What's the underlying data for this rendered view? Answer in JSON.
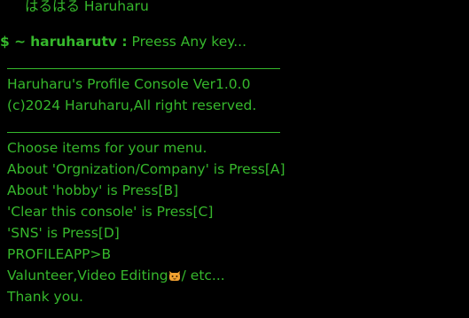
{
  "header": {
    "title": "はるはる Haruharu"
  },
  "prompt": {
    "symbol": "$ ~",
    "user": "haruharutv :",
    "message": "Preess Any key..."
  },
  "console": {
    "banner_line1": "Haruharu's Profile Console Ver1.0.0",
    "banner_line2": "(c)2024 Haruharu,All right reserved."
  },
  "menu": {
    "intro": "Choose items for your menu.",
    "items": [
      "About 'Orgnization/Company' is Press[A]",
      "About 'hobby' is Press[B]",
      "'Clear this console' is Press[C]",
      "'SNS' is Press[D]"
    ],
    "input_line": "PROFILEAPP>B",
    "hobby_prefix": "Valunteer,Video Editing",
    "hobby_icon": "cat-face-icon",
    "hobby_suffix": "/ etc...",
    "closing": "Thank you."
  },
  "colors": {
    "background": "#000000",
    "text": "#36b82c",
    "icon": "#f0a030"
  }
}
